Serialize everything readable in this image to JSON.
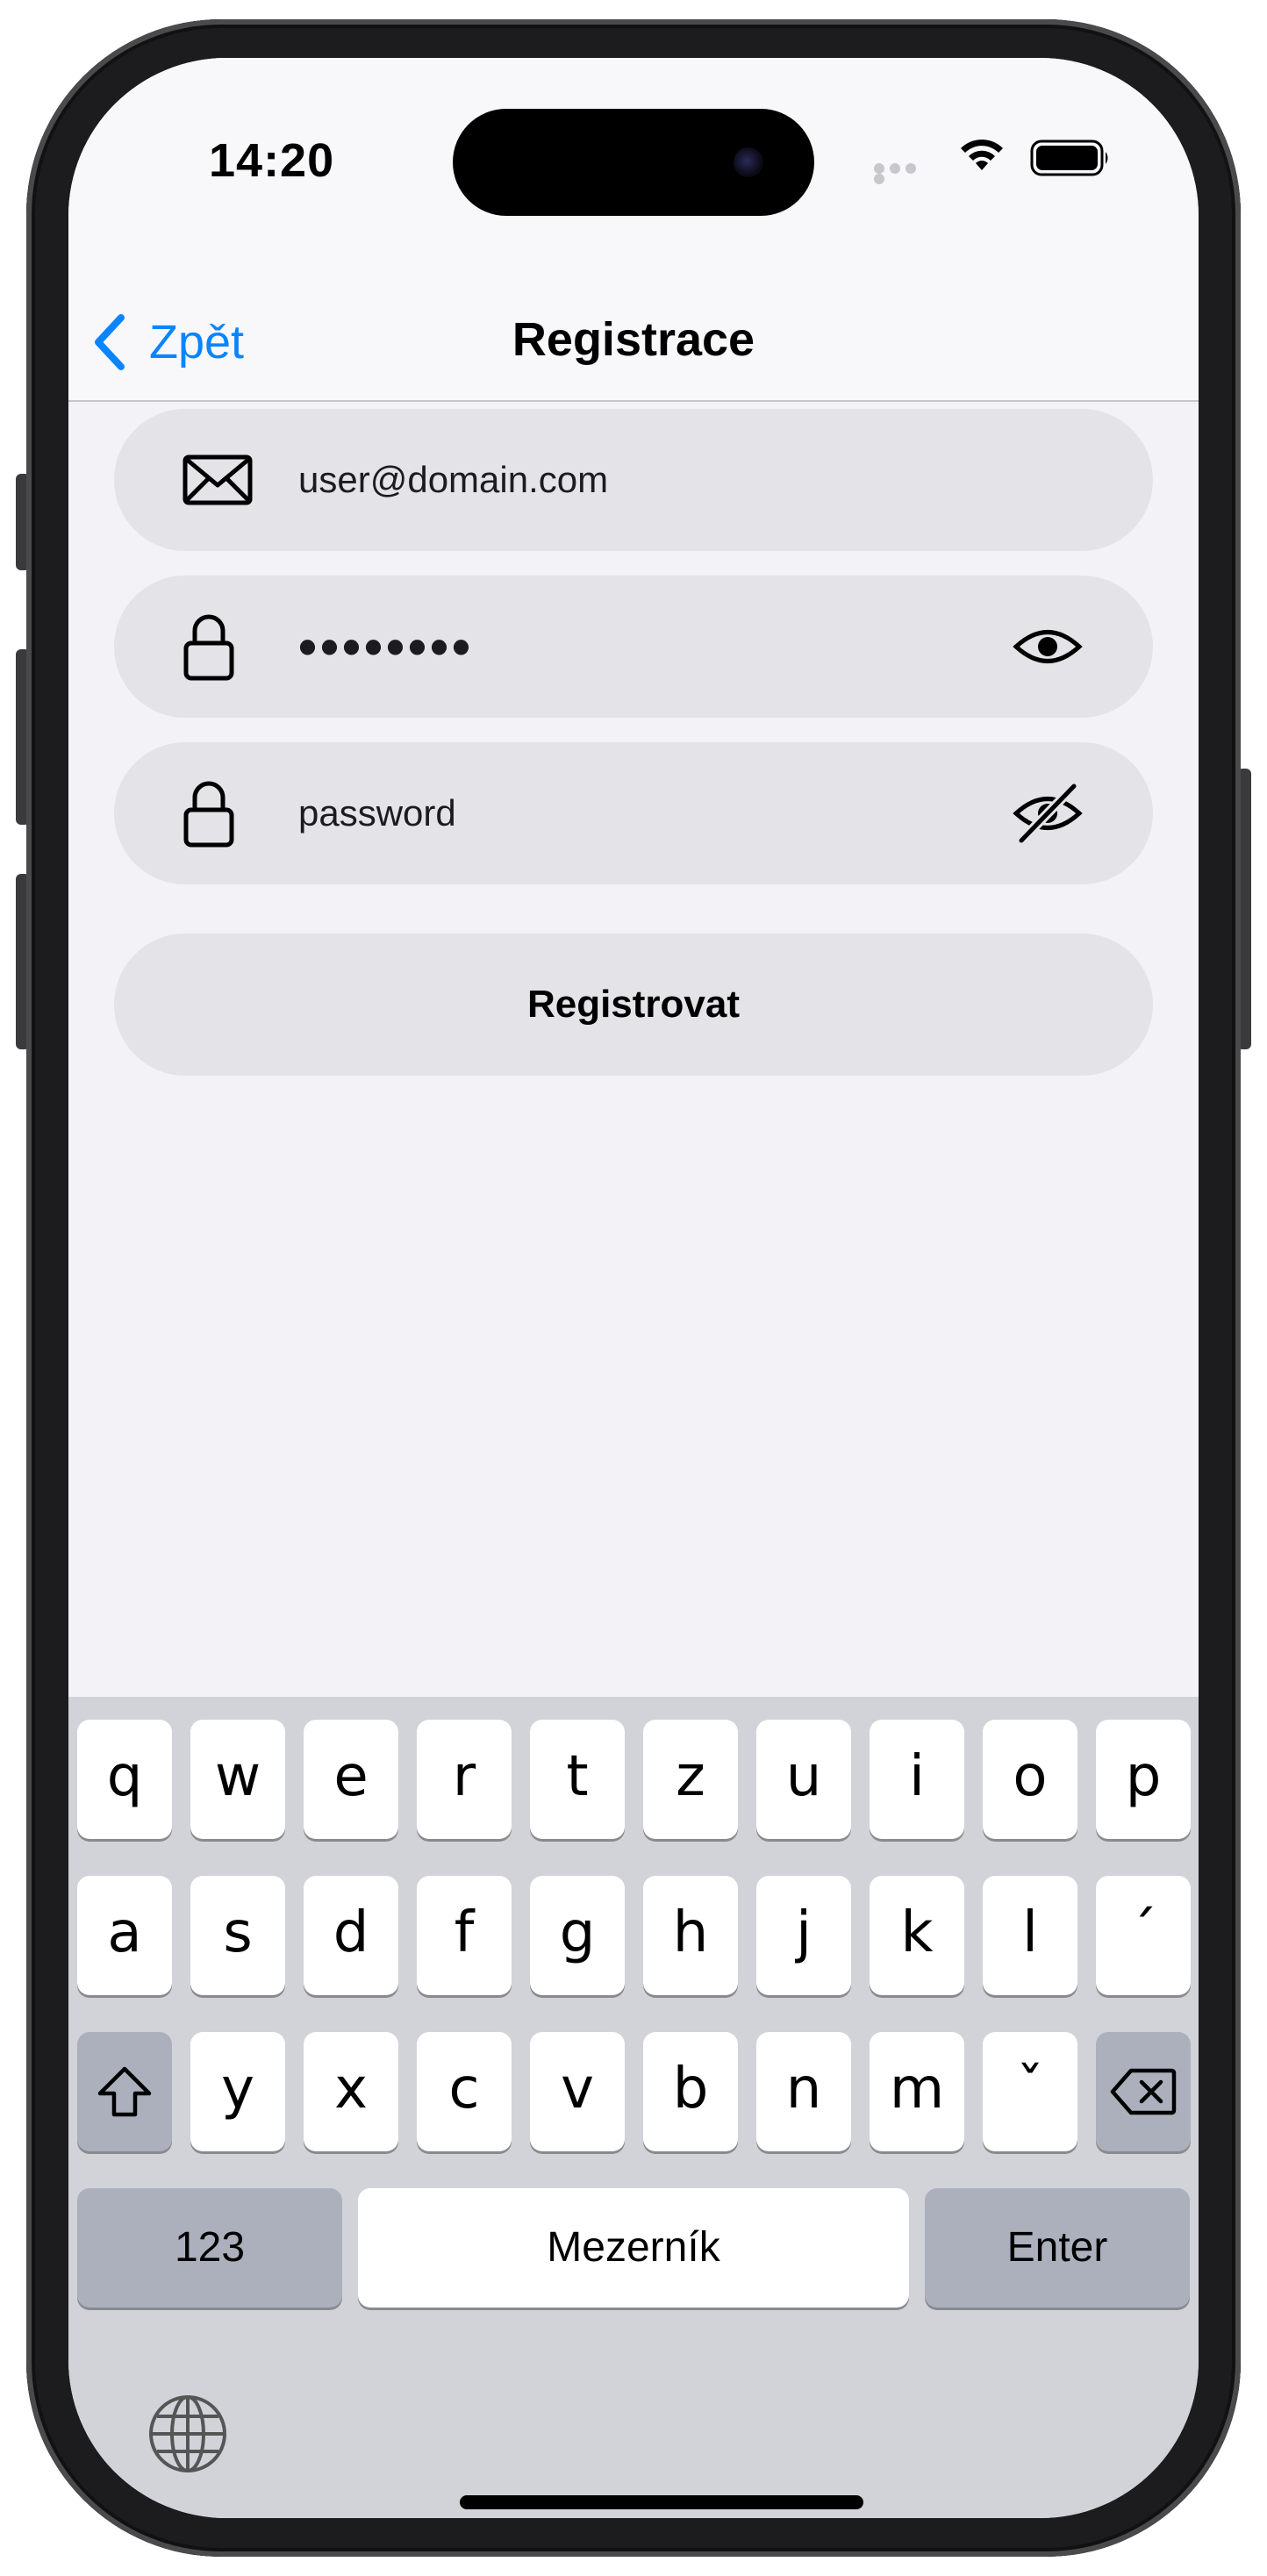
{
  "status_bar": {
    "time": "14:20"
  },
  "nav": {
    "back_label": "Zpět",
    "title": "Registrace"
  },
  "form": {
    "email_value": "user@domain.com",
    "password_value": "••••••••",
    "password_confirm_value": "password",
    "register_label": "Registrovat"
  },
  "keyboard": {
    "row1": [
      "q",
      "w",
      "e",
      "r",
      "t",
      "z",
      "u",
      "i",
      "o",
      "p"
    ],
    "row2": [
      "a",
      "s",
      "d",
      "f",
      "g",
      "h",
      "j",
      "k",
      "l",
      "´"
    ],
    "row3": [
      "y",
      "x",
      "c",
      "v",
      "b",
      "n",
      "m",
      "ˇ"
    ],
    "numbers_label": "123",
    "space_label": "Mezerník",
    "enter_label": "Enter"
  },
  "colors": {
    "accent": "#0a84ff",
    "field_background": "#e3e3e8",
    "screen_background": "#f2f2f7",
    "keyboard_background": "#d1d3d9"
  },
  "icons": {
    "email_field": "envelope-icon",
    "password_field": "lock-icon",
    "password_visible_toggle": "eye-icon",
    "password_hidden_toggle": "eye-slash-icon",
    "back": "chevron-left-icon",
    "shift": "shift-icon",
    "delete": "backspace-icon",
    "language": "globe-icon"
  }
}
